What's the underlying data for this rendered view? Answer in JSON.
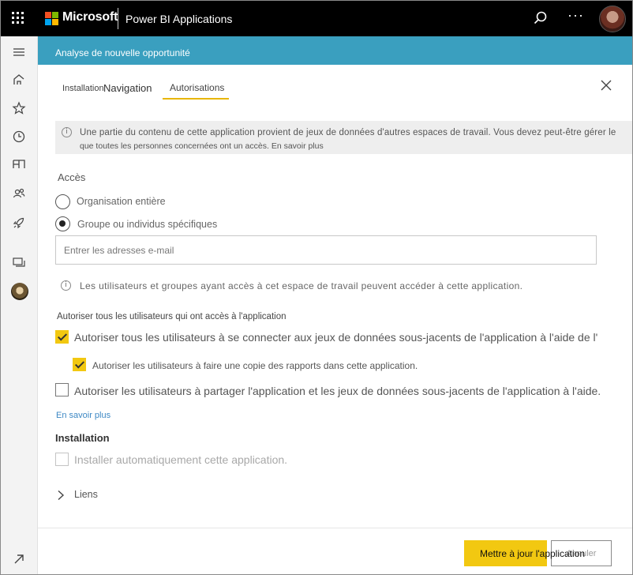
{
  "topbar": {
    "brand": "Microsoft",
    "app_title": "Power BI Applications",
    "more_label": "···"
  },
  "header": {
    "title": "Analyse de nouvelle opportunité"
  },
  "tabs": [
    {
      "label": "Installation"
    },
    {
      "label": "Navigation"
    },
    {
      "label": "Autorisations",
      "active": true
    }
  ],
  "info_banner": {
    "line1": "Une partie du contenu de cette application provient de jeux de données d'autres espaces de travail. Vous devez peut-être gérer le",
    "line2": "que toutes les personnes concernées ont un accès. En savoir plus"
  },
  "access": {
    "title": "Accès",
    "options": [
      {
        "label": "Organisation entière",
        "selected": false
      },
      {
        "label": "Groupe ou individus spécifiques",
        "selected": true
      }
    ],
    "email_placeholder": "Entrer les adresses e-mail",
    "note": "Les utilisateurs et groupes ayant accès à cet espace de travail peuvent accéder à cette application."
  },
  "permissions": {
    "title": "Autoriser tous les utilisateurs qui ont accès à l'application",
    "items": [
      {
        "label": "Autoriser tous les utilisateurs à se connecter aux jeux de données sous-jacents de l'application à l'aide de l'",
        "checked": true
      },
      {
        "label": "Autoriser les utilisateurs à faire une copie des rapports dans cette application.",
        "checked": true
      },
      {
        "label": "Autoriser les utilisateurs à partager l'application et les jeux de données sous-jacents de l'application à l'aide.",
        "checked": false
      }
    ],
    "learn_more": "En savoir plus"
  },
  "installation": {
    "title": "Installation",
    "auto_install_label": "Installer automatiquement cette application.",
    "auto_install_checked": false
  },
  "links": {
    "label": "Liens"
  },
  "footer": {
    "update_label": "Mettre à jour l'application",
    "cancel_label": "Annuler"
  },
  "colors": {
    "accent_yellow": "#f2c811",
    "band_blue": "#3a9fbf",
    "link_blue": "#3d88c4"
  }
}
